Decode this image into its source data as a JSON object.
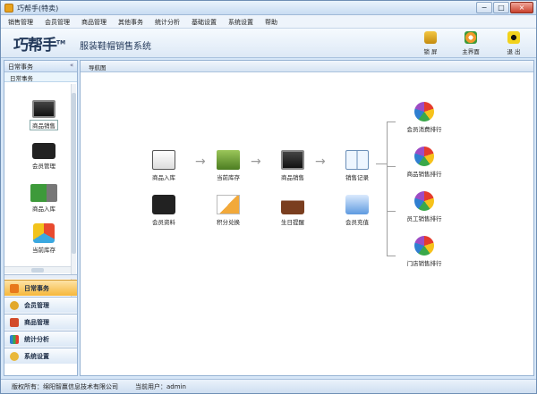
{
  "window": {
    "title": "巧帮手(特卖)",
    "min": "−",
    "max": "□",
    "close": "×"
  },
  "menu": [
    "销售管理",
    "会员管理",
    "商品管理",
    "其他事务",
    "统计分析",
    "基础设置",
    "系统设置",
    "帮助"
  ],
  "header": {
    "logo": "巧帮手",
    "logo_tm": "TM",
    "subtitle": "服装鞋帽销售系统",
    "buttons": [
      {
        "label": "锁 屏",
        "icon": "lock-icon"
      },
      {
        "label": "主界面",
        "icon": "home-gear-icon"
      },
      {
        "label": "退 出",
        "icon": "power-icon"
      }
    ]
  },
  "sidebar": {
    "title": "日常事务",
    "collapse": "«",
    "subtitle": "日常事务",
    "items": [
      {
        "label": "商品销售",
        "icon": "monitor-icon"
      },
      {
        "label": "会员管理",
        "icon": "member-card-icon"
      },
      {
        "label": "商品入库",
        "icon": "truck-icon"
      },
      {
        "label": "当前库存",
        "icon": "boxes-icon"
      }
    ],
    "groups": [
      {
        "label": "日常事务",
        "active": true
      },
      {
        "label": "会员管理"
      },
      {
        "label": "商品管理"
      },
      {
        "label": "统计分析"
      },
      {
        "label": "系统设置"
      }
    ]
  },
  "content": {
    "tab": "导航图",
    "flow": [
      {
        "label": "商品入库",
        "icon": "checklist-icon"
      },
      {
        "label": "当前库存",
        "icon": "inventory-box-icon"
      },
      {
        "label": "商品销售",
        "icon": "monitor-icon"
      },
      {
        "label": "销售记录",
        "icon": "open-book-icon"
      }
    ],
    "row2": [
      {
        "label": "会员资料",
        "icon": "member-card-icon"
      },
      {
        "label": "积分兑换",
        "icon": "pencil-doc-icon"
      },
      {
        "label": "生日提醒",
        "icon": "birthday-cake-icon"
      },
      {
        "label": "会员充值",
        "icon": "recharge-card-icon"
      }
    ],
    "ranks": [
      "会员消费排行",
      "商品销售排行",
      "员工销售排行",
      "门店销售排行"
    ]
  },
  "status": {
    "copyright": "版权所有：绵阳智赢信息技术有限公司",
    "user": "当前用户：admin"
  }
}
